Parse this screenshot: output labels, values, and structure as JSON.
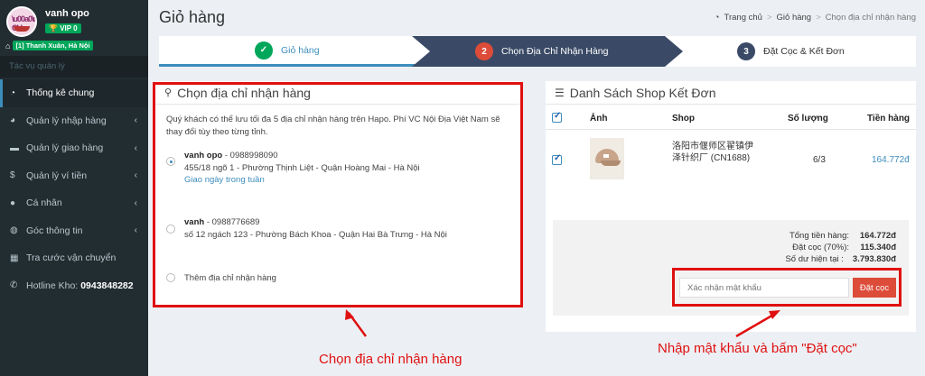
{
  "sidebar": {
    "user_name": "vanh opo",
    "vip": "VIP 0",
    "location": "[1] Thanh Xuân, Hà Nội",
    "menu_header": "Tác vụ quản lý",
    "items": [
      {
        "label": "Thống kê chung",
        "icon": "dashboard-icon"
      },
      {
        "label": "Quản lý nhập hàng",
        "icon": "pie-chart-icon"
      },
      {
        "label": "Quản lý giao hàng",
        "icon": "truck-icon"
      },
      {
        "label": "Quản lý ví tiền",
        "icon": "dollar-icon"
      },
      {
        "label": "Cá nhân",
        "icon": "user-icon"
      },
      {
        "label": "Góc thông tin",
        "icon": "globe-icon"
      },
      {
        "label": "Tra cước vận chuyển",
        "icon": "calculator-icon"
      },
      {
        "label": "Hotline Kho:",
        "value": "0943848282",
        "icon": "phone-icon"
      }
    ]
  },
  "header": {
    "title": "Giỏ hàng",
    "breadcrumb": [
      "Trang chủ",
      "Giỏ hàng",
      "Chọn địa chỉ nhận hàng"
    ]
  },
  "steps": [
    {
      "num": "✓",
      "label": "Giỏ hàng"
    },
    {
      "num": "2",
      "label": "Chọn Địa Chỉ Nhận Hàng"
    },
    {
      "num": "3",
      "label": "Đặt Cọc & Kết Đơn"
    }
  ],
  "address_panel": {
    "title": "Chọn địa chỉ nhận hàng",
    "note": "Quý khách có thể lưu tối đa 5 địa chỉ nhận hàng trên Hapo. Phí VC Nội Địa Việt Nam sẽ thay đổi tùy theo từng tỉnh.",
    "addresses": [
      {
        "name": "vanh opo",
        "phone": " - 0988998090",
        "line": "455/18 ngõ 1 - Phường Thịnh Liệt - Quận Hoàng Mai - Hà Nội",
        "extra": "Giao ngày trong tuần"
      },
      {
        "name": "vanh",
        "phone": " - 0988776689",
        "line": "số 12 ngách 123 - Phường Bách Khoa - Quận Hai Bà Trưng - Hà Nội"
      }
    ],
    "add_label": "Thêm địa chỉ nhận hàng"
  },
  "shop_panel": {
    "title": "Danh Sách Shop Kết Đơn",
    "columns": [
      "Ảnh",
      "Shop",
      "Số lượng",
      "Tiền hàng"
    ],
    "rows": [
      {
        "shop": "洛阳市偃师区翟镇伊泽针织厂 (CN1688)",
        "qty": "6/3",
        "amount": "164.772đ"
      }
    ],
    "totals": [
      {
        "label": "Tổng tiền hàng:",
        "value": "164.772đ"
      },
      {
        "label": "Đặt cọc (70%):",
        "value": "115.340đ"
      },
      {
        "label": "Số dư hiện tại :",
        "value": "3.793.830đ"
      }
    ],
    "password_placeholder": "Xác nhận mật khẩu",
    "deposit_button": "Đặt cọc"
  },
  "annotations": {
    "left": "Chọn địa chỉ nhận hàng",
    "right": "Nhập mật khẩu và bấm \"Đặt cọc\"",
    "color": "#e01010"
  }
}
